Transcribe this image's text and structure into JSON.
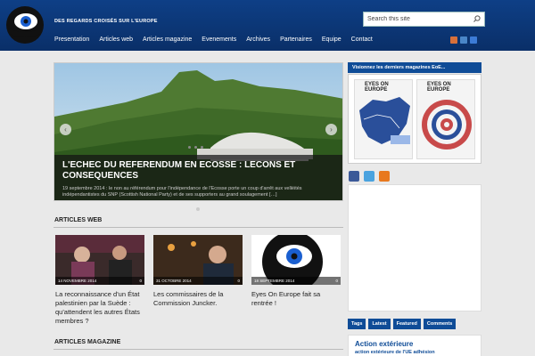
{
  "header": {
    "tagline": "DES REGARDS CROISÉS SUR L'EUROPE",
    "search_placeholder": "Search this site",
    "nav": [
      "Presentation",
      "Articles web",
      "Articles magazine",
      "Evenements",
      "Archives",
      "Partenaires",
      "Equipe",
      "Contact"
    ]
  },
  "slider": {
    "title": "L'ECHEC DU REFERENDUM EN ECOSSE : LECONS ET CONSEQUENCES",
    "excerpt": "19 septembre 2014 : le non au référendum pour l'indépendance de l'Ecosse porte un coup d'arrêt aux velléités indépendantistes du SNP (Scottish National Party) et de ses supporters au grand soulagement […]"
  },
  "sections": {
    "web": "ARTICLES WEB",
    "magazine": "ARTICLES MAGAZINE"
  },
  "articles": [
    {
      "date": "14 NOVEMBRE 2014",
      "comments": "0",
      "title": "La reconnaissance d'un État palestinien par la Suède : qu'attendent les autres États membres ?"
    },
    {
      "date": "31 OCTOBRE 2014",
      "comments": "0",
      "title": "Les commissaires de la Commission Juncker."
    },
    {
      "date": "18 SEPTEMBRE 2014",
      "comments": "0",
      "title": "Eyes On Europe fait sa rentrée !"
    }
  ],
  "sidebar": {
    "magazines_title": "Visionnez les derniers magazines EoE...",
    "magazine_brand": "EYES ON EUROPE",
    "tabs": [
      "Tags",
      "Latest",
      "Featured",
      "Comments"
    ],
    "tag_big": "Action extérieure",
    "tag_small": "action extérieure de l'UE   adhésion"
  },
  "colors": {
    "brand_blue": "#0f4c97",
    "header_blue": "#0e3f86"
  }
}
